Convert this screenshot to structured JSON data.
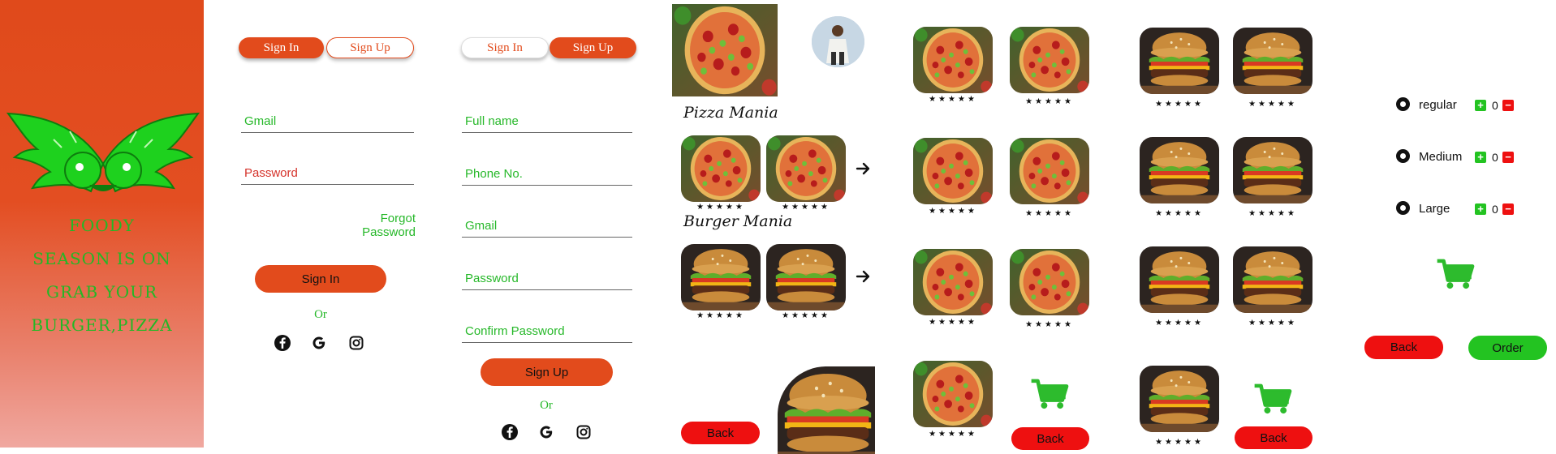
{
  "splash": {
    "tagline_lines": [
      "FOODY",
      "SEASON IS ON",
      "GRAB YOUR",
      "BURGER,PIZZA"
    ],
    "logo_icon": "green-wings-emblem-icon"
  },
  "signin": {
    "tabs": [
      "Sign In",
      "Sign Up"
    ],
    "fields": [
      "Gmail",
      "Password"
    ],
    "forgot_label": "Forgot Password",
    "submit_label": "Sign In",
    "or_label": "Or"
  },
  "signup": {
    "tabs": [
      "Sign In",
      "Sign Up"
    ],
    "fields": [
      "Full name",
      "Phone No.",
      "Gmail",
      "Password",
      "Confirm Password"
    ],
    "submit_label": "Sign Up",
    "or_label": "Or"
  },
  "social_icons": [
    "facebook-icon",
    "google-icon",
    "instagram-icon"
  ],
  "home": {
    "pizza_title": "Pizza Mania",
    "burger_title": "Burger Mania",
    "back_label": "Back",
    "stars": "★★★★★"
  },
  "pizza_list": {
    "stars": "★★★★★",
    "back_label": "Back"
  },
  "burger_list": {
    "stars": "★★★★★",
    "back_label": "Back"
  },
  "order": {
    "sizes": [
      {
        "label": "regular",
        "qty": "0"
      },
      {
        "label": "Medium",
        "qty": "0"
      },
      {
        "label": "Large",
        "qty": "0"
      }
    ],
    "back_label": "Back",
    "order_label": "Order"
  },
  "colors": {
    "brand_orange": "#e24b1c",
    "accent_green": "#23c321",
    "danger_red": "#ee1010"
  }
}
